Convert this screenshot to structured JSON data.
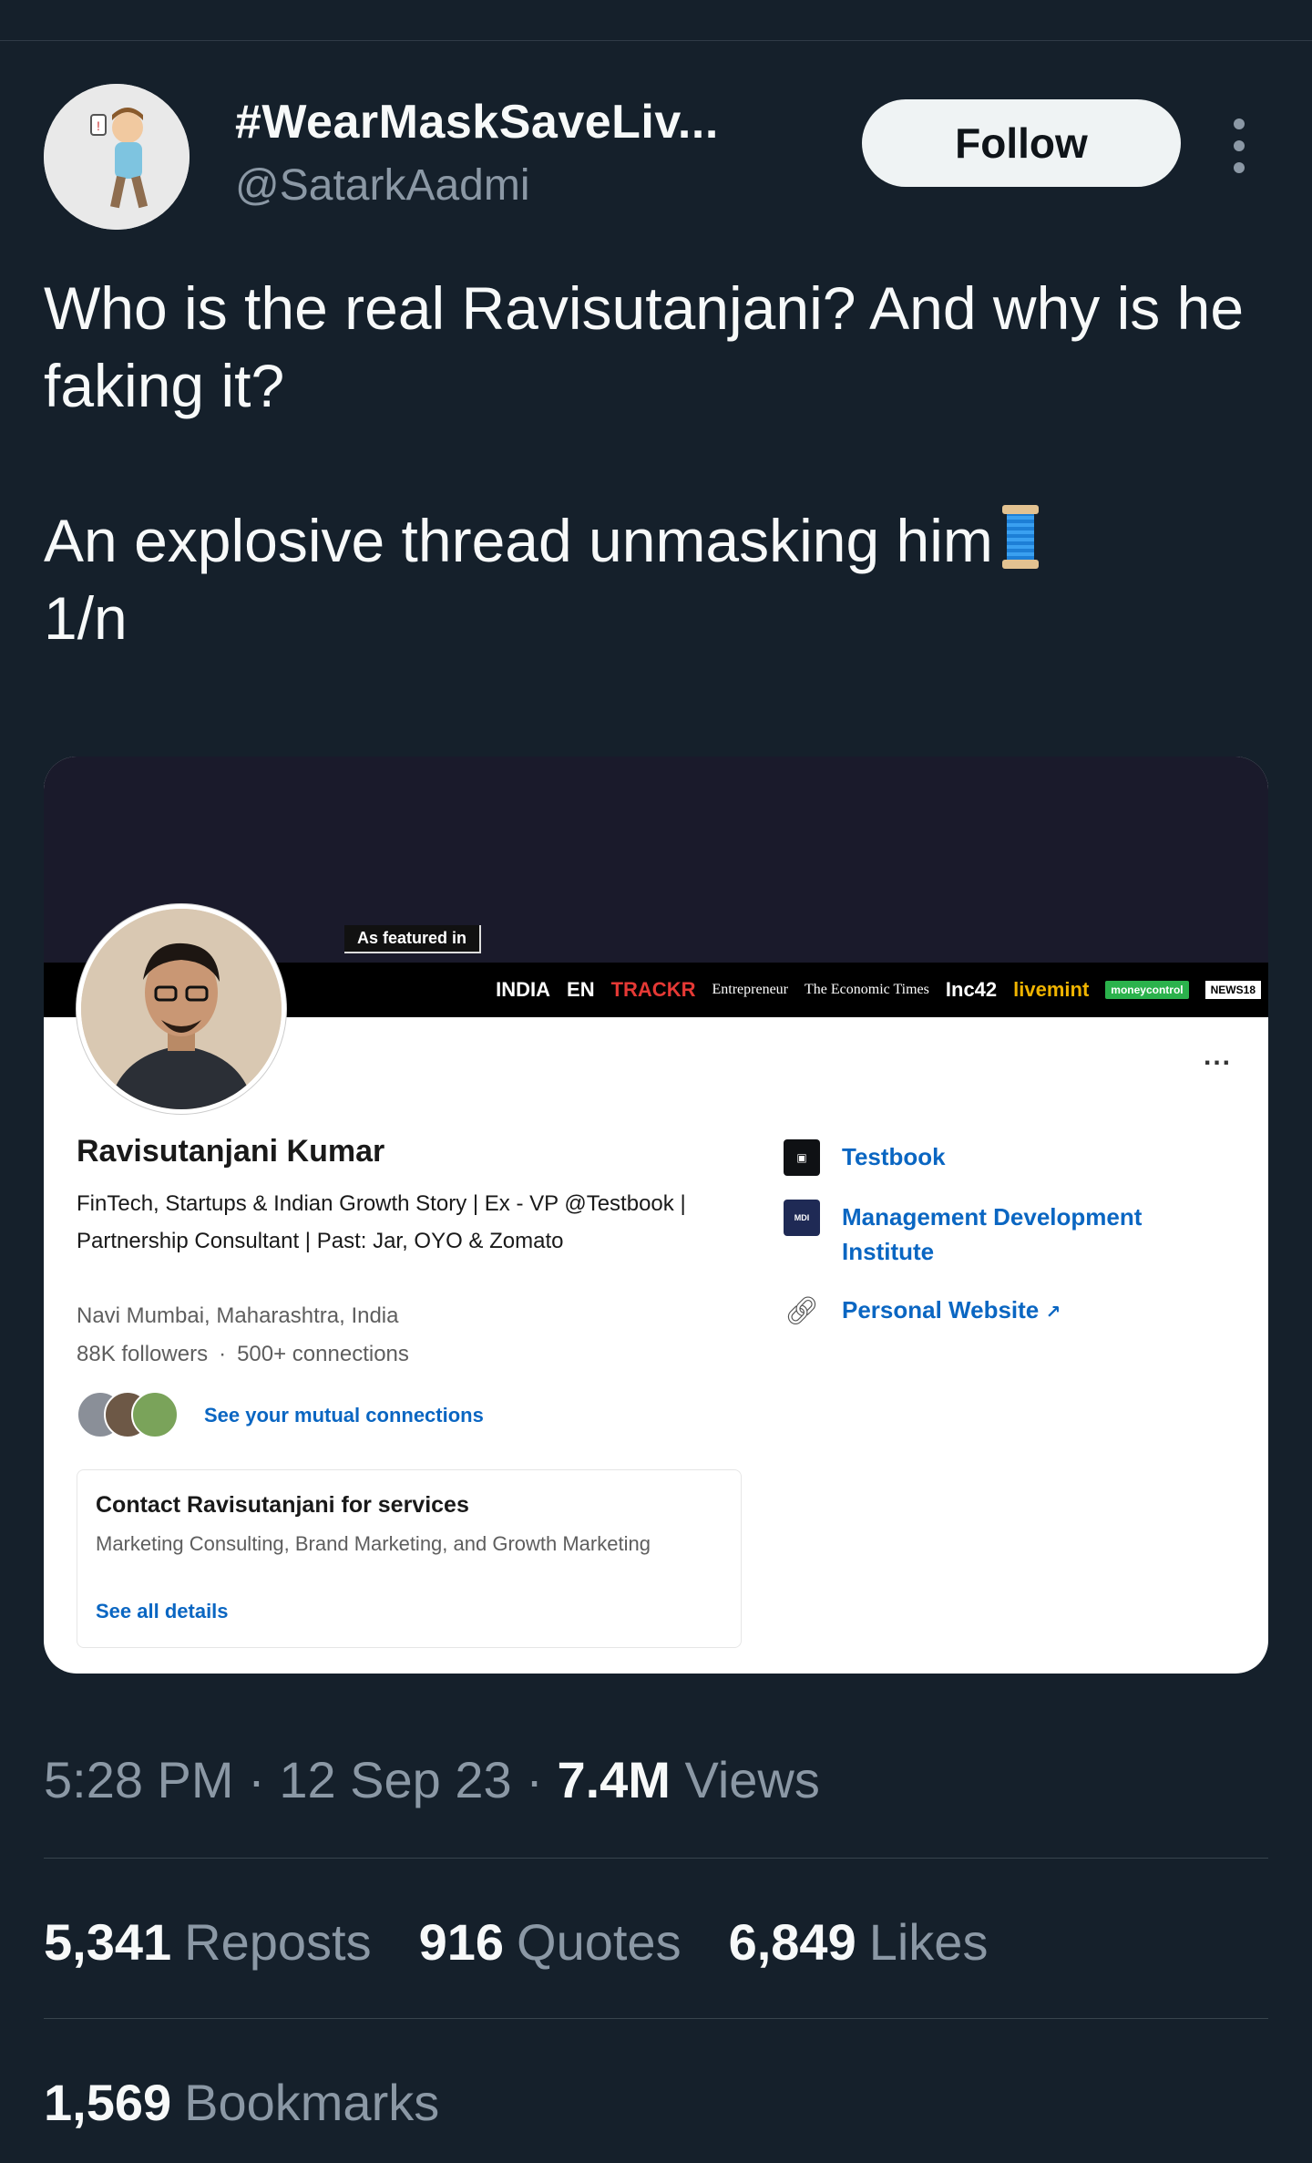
{
  "author": {
    "display_name": "#WearMaskSaveLiv...",
    "handle": "@SatarkAadmi",
    "follow_label": "Follow"
  },
  "tweet": {
    "line1": "Who is the real Ravisutanjani? And why is he faking it?",
    "line2": "An explosive thread unmasking him",
    "line3": "1/n"
  },
  "card": {
    "featured_label": "As featured in",
    "press": [
      "INDIA",
      "EN",
      "TRACKR",
      "Entrepreneur",
      "The Economic Times",
      "Inc42",
      "livemint",
      "moneycontrol",
      "NEWS18"
    ],
    "more_label": "...",
    "profile": {
      "name": "Ravisutanjani Kumar",
      "headline": "FinTech, Startups & Indian Growth Story | Ex - VP @Testbook | Partnership Consultant | Past: Jar, OYO & Zomato",
      "location": "Navi Mumbai, Maharashtra, India",
      "followers": "88K followers",
      "connections": "500+ connections",
      "mutual_link": "See your mutual connections"
    },
    "contact": {
      "title": "Contact Ravisutanjani for services",
      "services": "Marketing Consulting, Brand Marketing, and Growth Marketing",
      "details_link": "See all details"
    },
    "side": [
      {
        "icon": "testbook-logo-icon",
        "label": "Testbook"
      },
      {
        "icon": "mdi-logo-icon",
        "label": "Management Development Institute"
      },
      {
        "icon": "link-icon",
        "label": "Personal Website"
      }
    ]
  },
  "meta": {
    "time": "5:28 PM",
    "date": "12 Sep 23",
    "views_count": "7.4M",
    "views_label": "Views"
  },
  "engagement": {
    "reposts_count": "5,341",
    "reposts_label": "Reposts",
    "quotes_count": "916",
    "quotes_label": "Quotes",
    "likes_count": "6,849",
    "likes_label": "Likes",
    "bookmarks_count": "1,569",
    "bookmarks_label": "Bookmarks"
  },
  "colors": {
    "background": "#15202b",
    "secondary_text": "#8b98a5",
    "link_blue": "#0a66c2"
  }
}
